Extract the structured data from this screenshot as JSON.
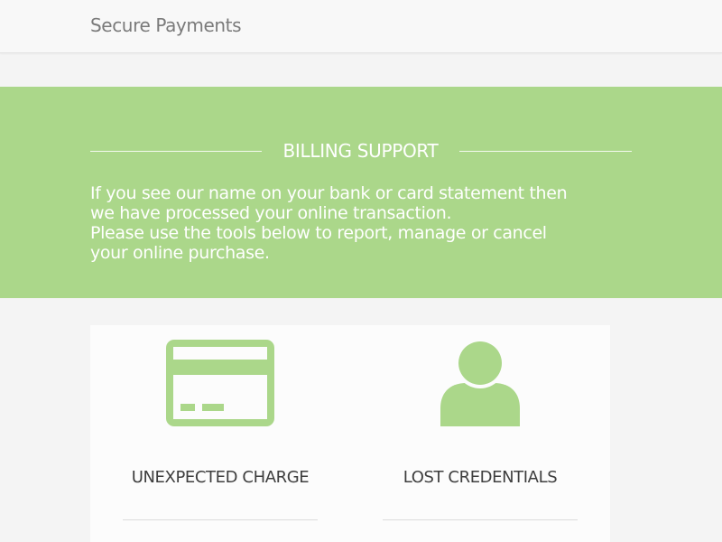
{
  "header": {
    "brand": "Secure Payments"
  },
  "hero": {
    "title": "BILLING SUPPORT",
    "lines": [
      "If you see our name on your bank or card statement then",
      "we have processed your online transaction.",
      "Please use the tools below to report, manage or cancel",
      "your online purchase."
    ]
  },
  "cards": [
    {
      "label": "UNEXPECTED CHARGE",
      "icon": "credit-card-icon"
    },
    {
      "label": "LOST CREDENTIALS",
      "icon": "user-icon"
    }
  ],
  "colors": {
    "accent": "#abd78a",
    "background": "#f4f4f4",
    "panel": "#fcfcfc",
    "heading_text": "#3e3e3e",
    "brand_text": "#7a7a7a"
  }
}
